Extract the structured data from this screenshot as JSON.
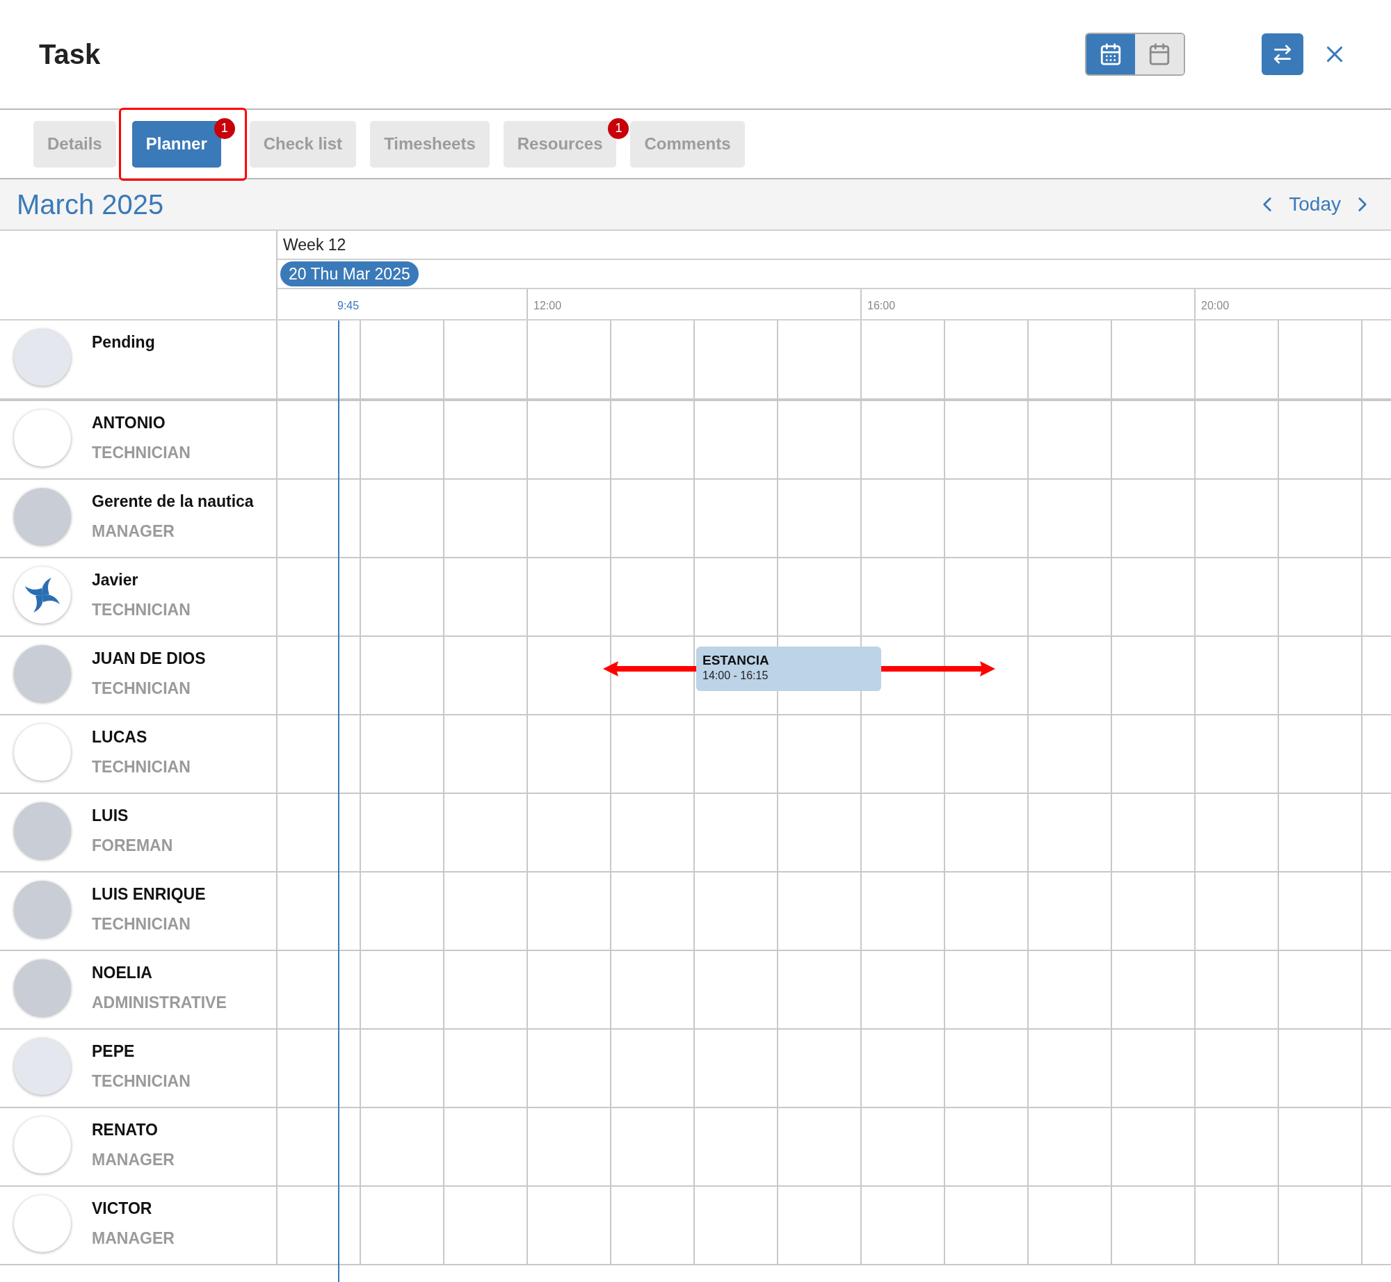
{
  "window": {
    "title": "Task"
  },
  "view_toggle": [
    {
      "kind": "day",
      "selected": true
    },
    {
      "kind": "month",
      "selected": false
    }
  ],
  "tabs": [
    {
      "label": "Details",
      "selected": false,
      "outlined": false
    },
    {
      "label": "Planner",
      "selected": true,
      "outlined": true,
      "badge": "1"
    },
    {
      "label": "Check list",
      "selected": false,
      "outlined": false
    },
    {
      "label": "Timesheets",
      "selected": false,
      "outlined": false
    },
    {
      "label": "Resources",
      "selected": false,
      "outlined": false,
      "badge": "1"
    },
    {
      "label": "Comments",
      "selected": false,
      "outlined": false
    }
  ],
  "planner": {
    "month": "March 2025",
    "today_label": "Today",
    "week": "Week 12",
    "day": "20 Thu Mar 2025",
    "now_label": "9:45",
    "hour_labels": [
      "12:00",
      "16:00",
      "20:00"
    ],
    "resources": [
      {
        "name": "Pending",
        "kind": "illustration"
      },
      {
        "name": "ANTONIO",
        "role": "TECHNICIAN",
        "kind": "blank"
      },
      {
        "name": "Gerente de la nautica",
        "role": "MANAGER",
        "kind": "photo"
      },
      {
        "name": "Javier",
        "role": "TECHNICIAN",
        "kind": "logo"
      },
      {
        "name": "JUAN DE DIOS",
        "role": "TECHNICIAN",
        "kind": "photo",
        "event": {
          "title": "ESTANCIA",
          "time": "14:00 - 16:15",
          "arrows": true
        }
      },
      {
        "name": "LUCAS",
        "role": "TECHNICIAN",
        "kind": "blank"
      },
      {
        "name": "LUIS",
        "role": "FOREMAN",
        "kind": "photo"
      },
      {
        "name": "LUIS ENRIQUE",
        "role": "TECHNICIAN",
        "kind": "photo"
      },
      {
        "name": "NOELIA",
        "role": "ADMINISTRATIVE",
        "kind": "photo"
      },
      {
        "name": "PEPE",
        "role": "TECHNICIAN",
        "kind": "illustration"
      },
      {
        "name": "RENATO",
        "role": "MANAGER",
        "kind": "blank"
      },
      {
        "name": "VICTOR",
        "role": "MANAGER",
        "kind": "blank"
      }
    ]
  }
}
